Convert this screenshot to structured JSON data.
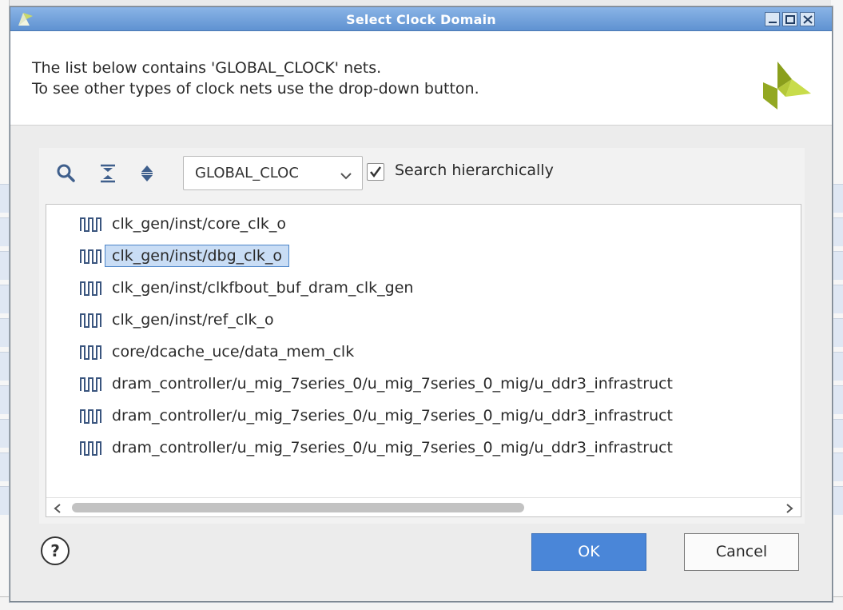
{
  "dialog": {
    "title": "Select Clock Domain",
    "message_line1": "The list below contains 'GLOBAL_CLOCK' nets.",
    "message_line2": "To see other types of clock nets use the drop-down button."
  },
  "toolbar": {
    "icons": [
      "search-icon",
      "collapse-all-icon",
      "expand-all-icon"
    ],
    "clock_type_select": "GLOBAL_CLOC",
    "search_hierarchically_label": "Search hierarchically",
    "search_hierarchically_checked": true
  },
  "nets": [
    {
      "name": "clk_gen/inst/core_clk_o",
      "selected": false
    },
    {
      "name": "clk_gen/inst/dbg_clk_o",
      "selected": true
    },
    {
      "name": "clk_gen/inst/clkfbout_buf_dram_clk_gen",
      "selected": false
    },
    {
      "name": "clk_gen/inst/ref_clk_o",
      "selected": false
    },
    {
      "name": "core/dcache_uce/data_mem_clk",
      "selected": false
    },
    {
      "name": "dram_controller/u_mig_7series_0/u_mig_7series_0_mig/u_ddr3_infrastruct",
      "selected": false
    },
    {
      "name": "dram_controller/u_mig_7series_0/u_mig_7series_0_mig/u_ddr3_infrastruct",
      "selected": false
    },
    {
      "name": "dram_controller/u_mig_7series_0/u_mig_7series_0_mig/u_ddr3_infrastruct",
      "selected": false
    }
  ],
  "buttons": {
    "help": "?",
    "ok": "OK",
    "cancel": "Cancel"
  },
  "colors": {
    "titlebar": "#5f92d1",
    "selection": "#c9ddf5",
    "ok_button": "#4a86d8",
    "logo_green": "#a8c424"
  }
}
